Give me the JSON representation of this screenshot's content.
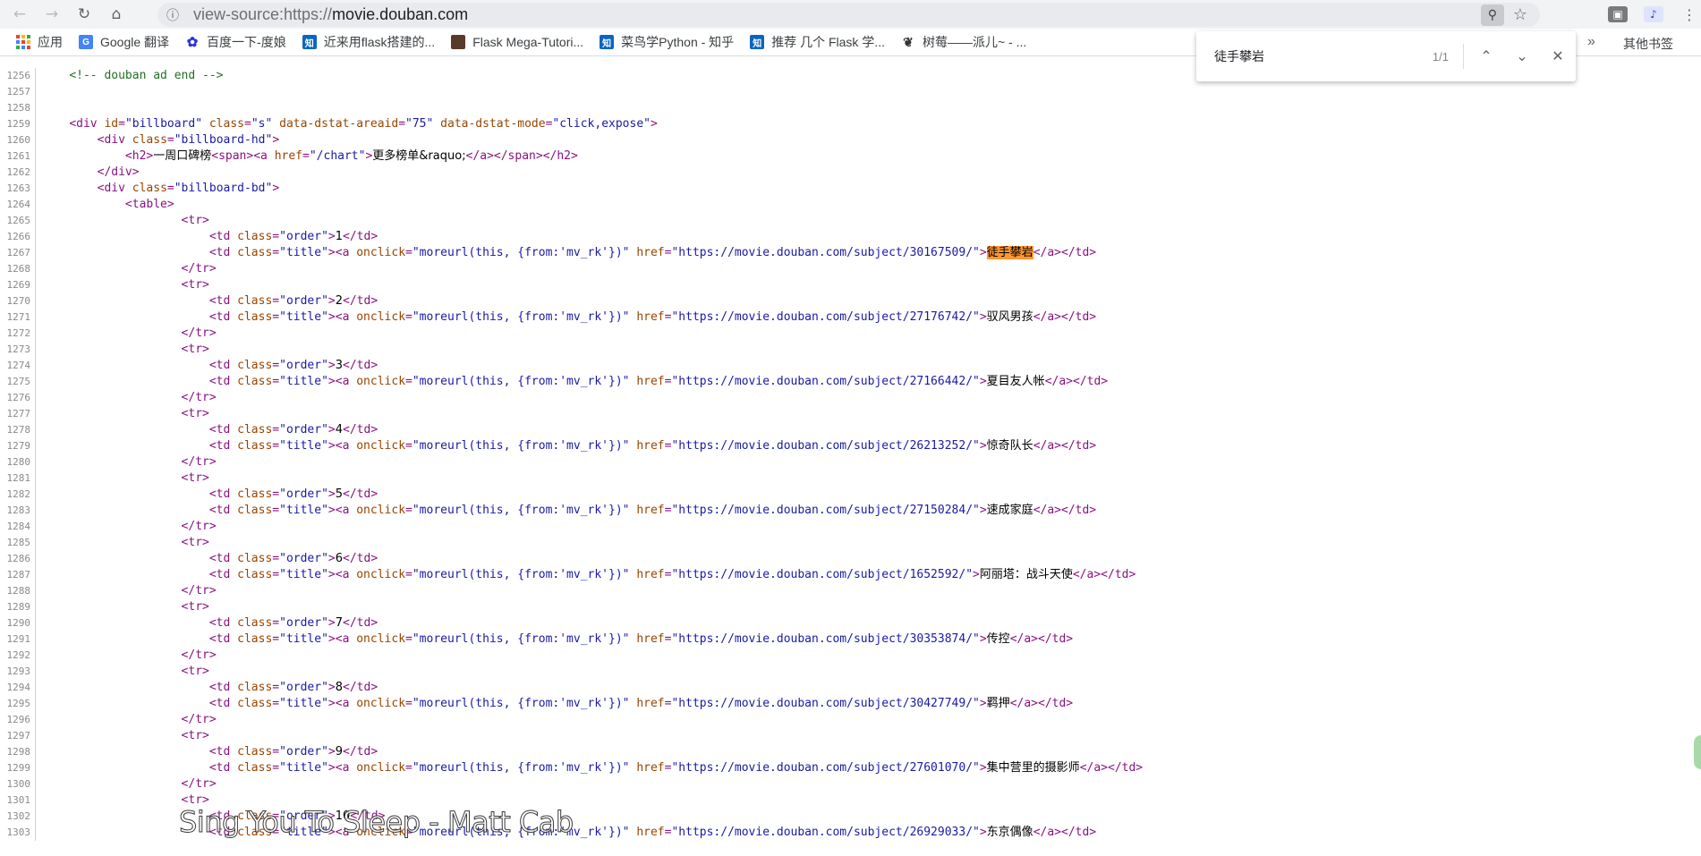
{
  "browser": {
    "url_scheme": "view-source:https://",
    "url_host": "movie.douban.com"
  },
  "bookmarks": [
    {
      "label": "应用",
      "icon": "apps-grid-icon"
    },
    {
      "label": "Google 翻译",
      "icon": "google-translate-icon"
    },
    {
      "label": "百度一下-度娘",
      "icon": "baidu-paw-icon"
    },
    {
      "label": "近来用flask搭建的...",
      "icon": "zhihu-icon"
    },
    {
      "label": "Flask Mega-Tutori...",
      "icon": "avatar-icon"
    },
    {
      "label": "菜鸟学Python - 知乎",
      "icon": "zhihu-icon"
    },
    {
      "label": "推荐 几个 Flask 学...",
      "icon": "zhihu-icon"
    },
    {
      "label": "树莓——派儿~ - ...",
      "icon": "raspberry-icon"
    }
  ],
  "bookmarks_more": "»",
  "bookmarks_other": "其他书签",
  "find": {
    "query": "徒手攀岩",
    "count": "1/1"
  },
  "source": {
    "comment": "<!-- douban ad end -->",
    "billboard": {
      "id": "billboard",
      "class": "s",
      "areaid": "75",
      "mode": "click,expose",
      "hd_class": "billboard-hd",
      "h2_text": "一周口碑榜",
      "chart_href": "/chart",
      "chart_text": "更多榜单&raquo;",
      "bd_class": "billboard-bd"
    },
    "onclick": "moreurl(this, {from:'mv_rk'})",
    "rows": [
      {
        "order": "1",
        "href": "https://movie.douban.com/subject/30167509/",
        "title": "徒手攀岩"
      },
      {
        "order": "2",
        "href": "https://movie.douban.com/subject/27176742/",
        "title": "驭风男孩"
      },
      {
        "order": "3",
        "href": "https://movie.douban.com/subject/27166442/",
        "title": "夏目友人帐"
      },
      {
        "order": "4",
        "href": "https://movie.douban.com/subject/26213252/",
        "title": "惊奇队长"
      },
      {
        "order": "5",
        "href": "https://movie.douban.com/subject/27150284/",
        "title": "速成家庭"
      },
      {
        "order": "6",
        "href": "https://movie.douban.com/subject/1652592/",
        "title": "阿丽塔：战斗天使"
      },
      {
        "order": "7",
        "href": "https://movie.douban.com/subject/30353874/",
        "title": "传控"
      },
      {
        "order": "8",
        "href": "https://movie.douban.com/subject/30427749/",
        "title": "羁押"
      },
      {
        "order": "9",
        "href": "https://movie.douban.com/subject/27601070/",
        "title": "集中营里的摄影师"
      },
      {
        "order": "10",
        "href": "https://movie.douban.com/subject/26929033/",
        "title": "东京偶像"
      }
    ],
    "first_line_number": 1256
  },
  "caption": "Sing You To Sleep - Matt Cab",
  "colors": {
    "tag": "#881280",
    "attr": "#994500",
    "value": "#1a1aa6",
    "comment": "#236e25",
    "highlight": "#ff9632"
  }
}
